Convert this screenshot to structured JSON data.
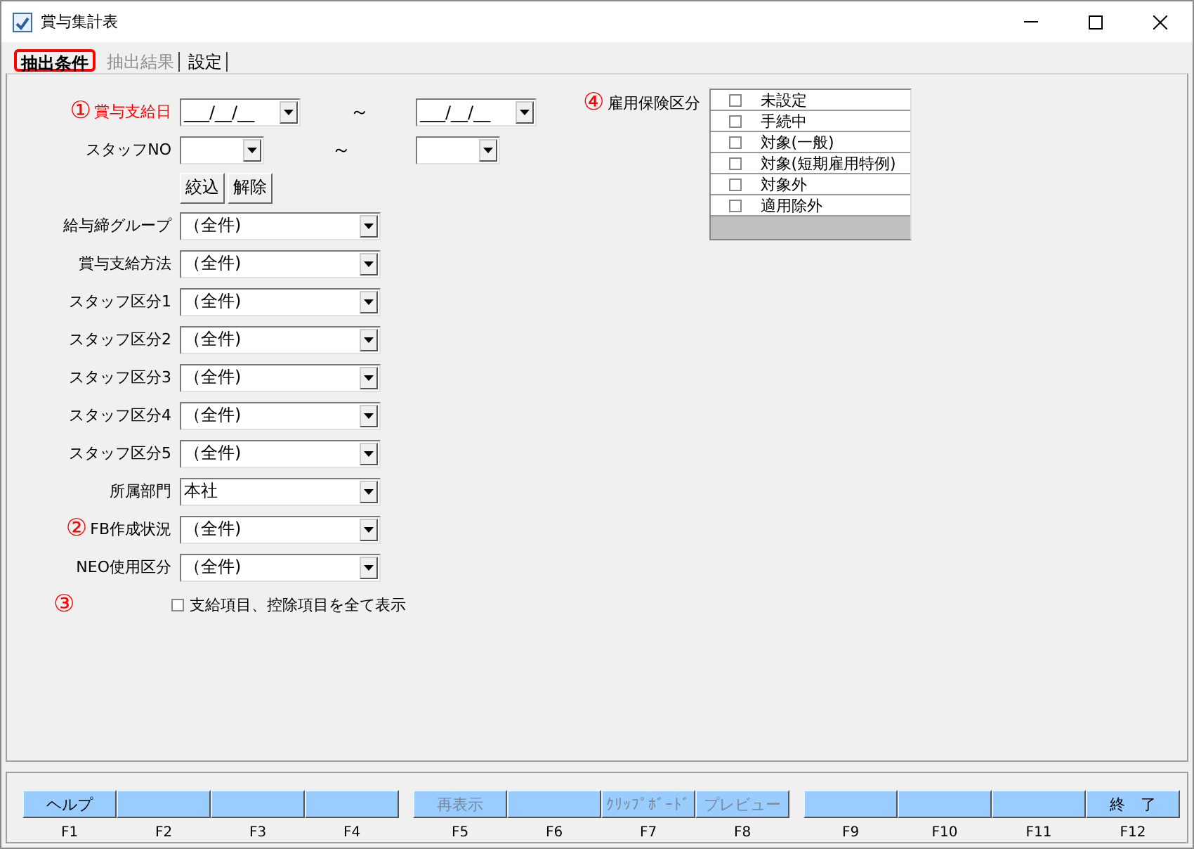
{
  "window": {
    "title": "賞与集計表"
  },
  "tabs": [
    {
      "label": "抽出条件",
      "selected": true,
      "disabled": false
    },
    {
      "label": "抽出結果",
      "selected": false,
      "disabled": true
    },
    {
      "label": "設定",
      "selected": false,
      "disabled": false
    }
  ],
  "payment_date": {
    "marker": "①",
    "label": "賞与支給日",
    "from": "___/__/__",
    "separator": "～",
    "to": "___/__/__"
  },
  "staff_no": {
    "label": "スタッフNO",
    "separator": "～"
  },
  "filter_buttons": [
    "絞込",
    "解除"
  ],
  "dropdowns": [
    {
      "label": "給与締グループ",
      "value": "（全件)"
    },
    {
      "label": "賞与支給方法",
      "value": "（全件)"
    },
    {
      "label": "スタッフ区分1",
      "value": "（全件)"
    },
    {
      "label": "スタッフ区分2",
      "value": "（全件)"
    },
    {
      "label": "スタッフ区分3",
      "value": "（全件)"
    },
    {
      "label": "スタッフ区分4",
      "value": "（全件)"
    },
    {
      "label": "スタッフ区分5",
      "value": "（全件)"
    },
    {
      "label": "所属部門",
      "value": "本社"
    },
    {
      "marker": "②",
      "label": "FB作成状況",
      "value": "（全件)"
    },
    {
      "label": "NEO使用区分",
      "value": "（全件)"
    }
  ],
  "show_all": {
    "marker": "③",
    "label": "支給項目、控除項目を全て表示",
    "checked": false
  },
  "insurance": {
    "marker": "④",
    "label": "雇用保険区分",
    "items": [
      {
        "label": "未設定",
        "checked": false
      },
      {
        "label": "手続中",
        "checked": false
      },
      {
        "label": "対象(一般)",
        "checked": false
      },
      {
        "label": "対象(短期雇用特例)",
        "checked": false
      },
      {
        "label": "対象外",
        "checked": false
      },
      {
        "label": "適用除外",
        "checked": false
      }
    ]
  },
  "function_keys": [
    {
      "label": "ヘルプ",
      "key": "F1",
      "disabled": false
    },
    {
      "key": "F2"
    },
    {
      "key": "F3"
    },
    {
      "key": "F4"
    },
    {
      "label": "再表示",
      "key": "F5",
      "disabled": true
    },
    {
      "key": "F6"
    },
    {
      "label": "ｸﾘｯﾌﾟﾎﾞｰﾄﾞ",
      "key": "F7",
      "disabled": true
    },
    {
      "label": "プレビュー",
      "key": "F8",
      "disabled": true
    },
    {
      "key": "F9"
    },
    {
      "key": "F10"
    },
    {
      "key": "F11"
    },
    {
      "label": "終　了",
      "key": "F12",
      "disabled": false
    }
  ]
}
